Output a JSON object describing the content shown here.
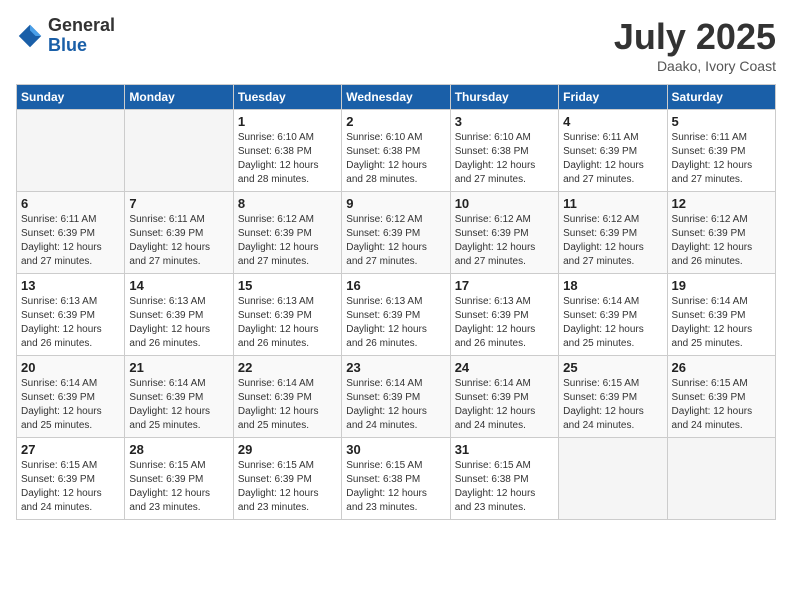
{
  "header": {
    "logo_general": "General",
    "logo_blue": "Blue",
    "month_title": "July 2025",
    "location": "Daako, Ivory Coast"
  },
  "calendar": {
    "days_of_week": [
      "Sunday",
      "Monday",
      "Tuesday",
      "Wednesday",
      "Thursday",
      "Friday",
      "Saturday"
    ],
    "weeks": [
      [
        {
          "day": "",
          "sunrise": "",
          "sunset": "",
          "daylight": ""
        },
        {
          "day": "",
          "sunrise": "",
          "sunset": "",
          "daylight": ""
        },
        {
          "day": "1",
          "sunrise": "Sunrise: 6:10 AM",
          "sunset": "Sunset: 6:38 PM",
          "daylight": "Daylight: 12 hours and 28 minutes."
        },
        {
          "day": "2",
          "sunrise": "Sunrise: 6:10 AM",
          "sunset": "Sunset: 6:38 PM",
          "daylight": "Daylight: 12 hours and 28 minutes."
        },
        {
          "day": "3",
          "sunrise": "Sunrise: 6:10 AM",
          "sunset": "Sunset: 6:38 PM",
          "daylight": "Daylight: 12 hours and 27 minutes."
        },
        {
          "day": "4",
          "sunrise": "Sunrise: 6:11 AM",
          "sunset": "Sunset: 6:39 PM",
          "daylight": "Daylight: 12 hours and 27 minutes."
        },
        {
          "day": "5",
          "sunrise": "Sunrise: 6:11 AM",
          "sunset": "Sunset: 6:39 PM",
          "daylight": "Daylight: 12 hours and 27 minutes."
        }
      ],
      [
        {
          "day": "6",
          "sunrise": "Sunrise: 6:11 AM",
          "sunset": "Sunset: 6:39 PM",
          "daylight": "Daylight: 12 hours and 27 minutes."
        },
        {
          "day": "7",
          "sunrise": "Sunrise: 6:11 AM",
          "sunset": "Sunset: 6:39 PM",
          "daylight": "Daylight: 12 hours and 27 minutes."
        },
        {
          "day": "8",
          "sunrise": "Sunrise: 6:12 AM",
          "sunset": "Sunset: 6:39 PM",
          "daylight": "Daylight: 12 hours and 27 minutes."
        },
        {
          "day": "9",
          "sunrise": "Sunrise: 6:12 AM",
          "sunset": "Sunset: 6:39 PM",
          "daylight": "Daylight: 12 hours and 27 minutes."
        },
        {
          "day": "10",
          "sunrise": "Sunrise: 6:12 AM",
          "sunset": "Sunset: 6:39 PM",
          "daylight": "Daylight: 12 hours and 27 minutes."
        },
        {
          "day": "11",
          "sunrise": "Sunrise: 6:12 AM",
          "sunset": "Sunset: 6:39 PM",
          "daylight": "Daylight: 12 hours and 27 minutes."
        },
        {
          "day": "12",
          "sunrise": "Sunrise: 6:12 AM",
          "sunset": "Sunset: 6:39 PM",
          "daylight": "Daylight: 12 hours and 26 minutes."
        }
      ],
      [
        {
          "day": "13",
          "sunrise": "Sunrise: 6:13 AM",
          "sunset": "Sunset: 6:39 PM",
          "daylight": "Daylight: 12 hours and 26 minutes."
        },
        {
          "day": "14",
          "sunrise": "Sunrise: 6:13 AM",
          "sunset": "Sunset: 6:39 PM",
          "daylight": "Daylight: 12 hours and 26 minutes."
        },
        {
          "day": "15",
          "sunrise": "Sunrise: 6:13 AM",
          "sunset": "Sunset: 6:39 PM",
          "daylight": "Daylight: 12 hours and 26 minutes."
        },
        {
          "day": "16",
          "sunrise": "Sunrise: 6:13 AM",
          "sunset": "Sunset: 6:39 PM",
          "daylight": "Daylight: 12 hours and 26 minutes."
        },
        {
          "day": "17",
          "sunrise": "Sunrise: 6:13 AM",
          "sunset": "Sunset: 6:39 PM",
          "daylight": "Daylight: 12 hours and 26 minutes."
        },
        {
          "day": "18",
          "sunrise": "Sunrise: 6:14 AM",
          "sunset": "Sunset: 6:39 PM",
          "daylight": "Daylight: 12 hours and 25 minutes."
        },
        {
          "day": "19",
          "sunrise": "Sunrise: 6:14 AM",
          "sunset": "Sunset: 6:39 PM",
          "daylight": "Daylight: 12 hours and 25 minutes."
        }
      ],
      [
        {
          "day": "20",
          "sunrise": "Sunrise: 6:14 AM",
          "sunset": "Sunset: 6:39 PM",
          "daylight": "Daylight: 12 hours and 25 minutes."
        },
        {
          "day": "21",
          "sunrise": "Sunrise: 6:14 AM",
          "sunset": "Sunset: 6:39 PM",
          "daylight": "Daylight: 12 hours and 25 minutes."
        },
        {
          "day": "22",
          "sunrise": "Sunrise: 6:14 AM",
          "sunset": "Sunset: 6:39 PM",
          "daylight": "Daylight: 12 hours and 25 minutes."
        },
        {
          "day": "23",
          "sunrise": "Sunrise: 6:14 AM",
          "sunset": "Sunset: 6:39 PM",
          "daylight": "Daylight: 12 hours and 24 minutes."
        },
        {
          "day": "24",
          "sunrise": "Sunrise: 6:14 AM",
          "sunset": "Sunset: 6:39 PM",
          "daylight": "Daylight: 12 hours and 24 minutes."
        },
        {
          "day": "25",
          "sunrise": "Sunrise: 6:15 AM",
          "sunset": "Sunset: 6:39 PM",
          "daylight": "Daylight: 12 hours and 24 minutes."
        },
        {
          "day": "26",
          "sunrise": "Sunrise: 6:15 AM",
          "sunset": "Sunset: 6:39 PM",
          "daylight": "Daylight: 12 hours and 24 minutes."
        }
      ],
      [
        {
          "day": "27",
          "sunrise": "Sunrise: 6:15 AM",
          "sunset": "Sunset: 6:39 PM",
          "daylight": "Daylight: 12 hours and 24 minutes."
        },
        {
          "day": "28",
          "sunrise": "Sunrise: 6:15 AM",
          "sunset": "Sunset: 6:39 PM",
          "daylight": "Daylight: 12 hours and 23 minutes."
        },
        {
          "day": "29",
          "sunrise": "Sunrise: 6:15 AM",
          "sunset": "Sunset: 6:39 PM",
          "daylight": "Daylight: 12 hours and 23 minutes."
        },
        {
          "day": "30",
          "sunrise": "Sunrise: 6:15 AM",
          "sunset": "Sunset: 6:38 PM",
          "daylight": "Daylight: 12 hours and 23 minutes."
        },
        {
          "day": "31",
          "sunrise": "Sunrise: 6:15 AM",
          "sunset": "Sunset: 6:38 PM",
          "daylight": "Daylight: 12 hours and 23 minutes."
        },
        {
          "day": "",
          "sunrise": "",
          "sunset": "",
          "daylight": ""
        },
        {
          "day": "",
          "sunrise": "",
          "sunset": "",
          "daylight": ""
        }
      ]
    ]
  }
}
